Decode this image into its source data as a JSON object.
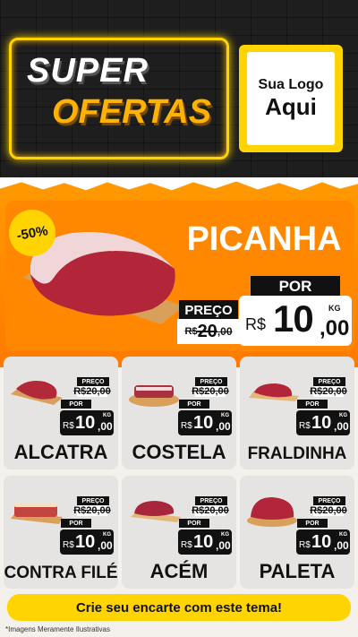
{
  "header": {
    "title_line1": "SUPER",
    "title_line2": "OFERTAS",
    "logo_line1": "Sua Logo",
    "logo_line2": "Aqui"
  },
  "hero": {
    "discount": "-50%",
    "product": "PICANHA",
    "preco_label": "PREÇO",
    "old_currency": "R$",
    "old_value": "20",
    "old_cents": ",00",
    "por_label": "POR",
    "new_currency": "R$",
    "new_value": "10",
    "new_cents": ",00",
    "unit": "KG"
  },
  "cards": [
    {
      "name": "ALCATRA",
      "preco_label": "PREÇO",
      "old_price": "R$20,00",
      "por_label": "POR",
      "currency": "R$",
      "value": "10",
      "cents": ",00",
      "unit": "KG"
    },
    {
      "name": "COSTELA",
      "preco_label": "PREÇO",
      "old_price": "R$20,00",
      "por_label": "POR",
      "currency": "R$",
      "value": "10",
      "cents": ",00",
      "unit": "KG"
    },
    {
      "name": "FRALDINHA",
      "preco_label": "PREÇO",
      "old_price": "R$20,00",
      "por_label": "POR",
      "currency": "R$",
      "value": "10",
      "cents": ",00",
      "unit": "KG"
    },
    {
      "name": "CONTRA FILÉ",
      "preco_label": "PREÇO",
      "old_price": "R$20,00",
      "por_label": "POR",
      "currency": "R$",
      "value": "10",
      "cents": ",00",
      "unit": "KG"
    },
    {
      "name": "ACÉM",
      "preco_label": "PREÇO",
      "old_price": "R$20,00",
      "por_label": "POR",
      "currency": "R$",
      "value": "10",
      "cents": ",00",
      "unit": "KG"
    },
    {
      "name": "PALETA",
      "preco_label": "PREÇO",
      "old_price": "R$20,00",
      "por_label": "POR",
      "currency": "R$",
      "value": "10",
      "cents": ",00",
      "unit": "KG"
    }
  ],
  "cta": "Crie seu encarte com este tema!",
  "footnote": "*Imagens Meramente Ilustrativas",
  "colors": {
    "accent": "#ffd400",
    "orange": "#ff8800",
    "dark": "#111111"
  },
  "icons": [
    "meat-icon"
  ]
}
